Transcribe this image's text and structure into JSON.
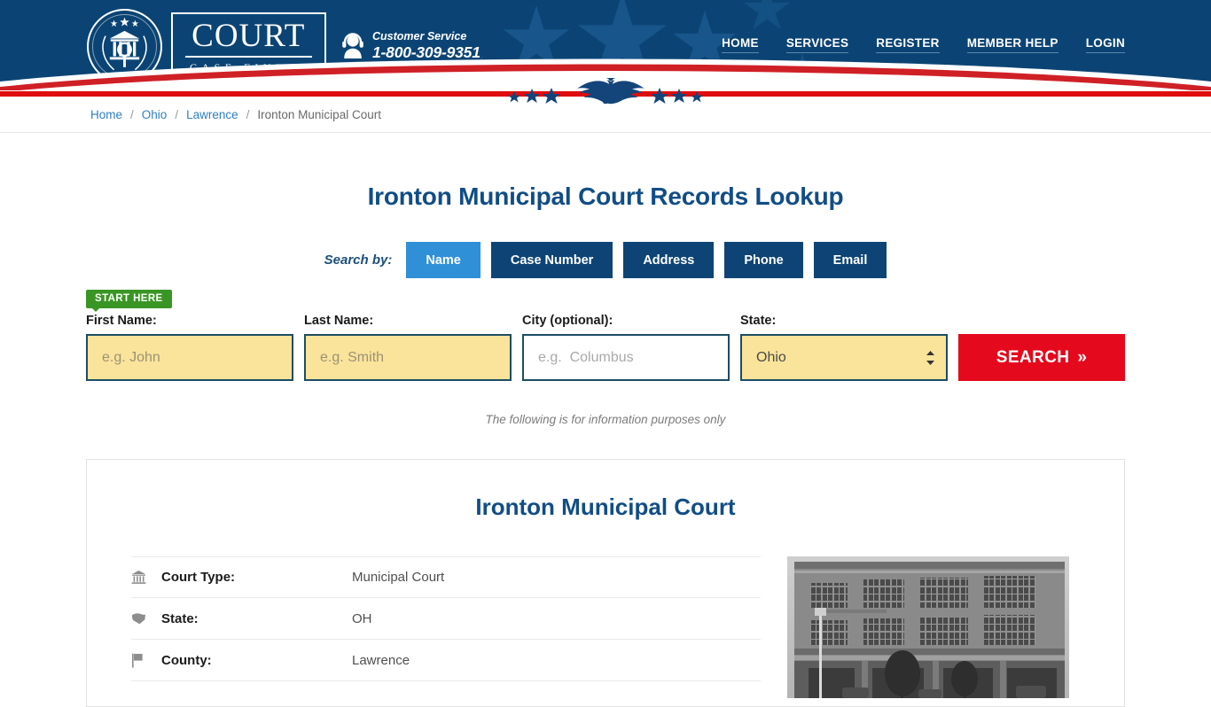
{
  "header": {
    "logo": {
      "icon": "court-seal-icon",
      "title": "COURT",
      "subtitle": "CASE FINDER"
    },
    "customer_service": {
      "icon": "headset-agent-icon",
      "label": "Customer Service",
      "phone": "1-800-309-9351"
    },
    "nav": [
      {
        "label": "HOME"
      },
      {
        "label": "SERVICES"
      },
      {
        "label": "REGISTER"
      },
      {
        "label": "MEMBER HELP"
      },
      {
        "label": "LOGIN"
      }
    ],
    "decoration": {
      "eagle_icon": "eagle-emblem-icon",
      "stars_icon": "stars-decoration-icon"
    },
    "colors": {
      "navy": "#0b4474",
      "red": "#e00d0d",
      "star": "#17558a"
    }
  },
  "breadcrumb": {
    "separator": "/",
    "items": [
      {
        "label": "Home",
        "link": true
      },
      {
        "label": "Ohio",
        "link": true
      },
      {
        "label": "Lawrence",
        "link": true
      },
      {
        "label": "Ironton Municipal Court",
        "link": false
      }
    ]
  },
  "main": {
    "page_title": "Ironton Municipal Court Records Lookup",
    "search_by_label": "Search by:",
    "tabs": [
      {
        "label": "Name",
        "active": true
      },
      {
        "label": "Case Number",
        "active": false
      },
      {
        "label": "Address",
        "active": false
      },
      {
        "label": "Phone",
        "active": false
      },
      {
        "label": "Email",
        "active": false
      }
    ],
    "start_badge": "START HERE",
    "form": {
      "first_name": {
        "label": "First Name:",
        "placeholder": "e.g. John",
        "value": ""
      },
      "last_name": {
        "label": "Last Name:",
        "placeholder": "e.g. Smith",
        "value": ""
      },
      "city": {
        "label": "City (optional):",
        "placeholder": "e.g.  Columbus",
        "value": ""
      },
      "state": {
        "label": "State:",
        "value": "Ohio"
      },
      "search_button": "SEARCH",
      "search_button_chevron": "»"
    },
    "disclaimer": "The following is for information purposes only"
  },
  "card": {
    "title": "Ironton Municipal Court",
    "details": [
      {
        "icon": "courthouse-icon",
        "label": "Court Type:",
        "value": "Municipal Court"
      },
      {
        "icon": "map-state-icon",
        "label": "State:",
        "value": "OH"
      },
      {
        "icon": "flag-icon",
        "label": "County:",
        "value": "Lawrence"
      }
    ],
    "photo": {
      "icon": "courthouse-photo",
      "alt": "Ironton Municipal Court building"
    }
  },
  "colors": {
    "accent_blue": "#114d86",
    "active_tab": "#2f90d8",
    "tab_navy": "#0d4475",
    "search_red": "#e4091c",
    "badge_green": "#3a9624",
    "input_yellow": "#fae49b"
  }
}
